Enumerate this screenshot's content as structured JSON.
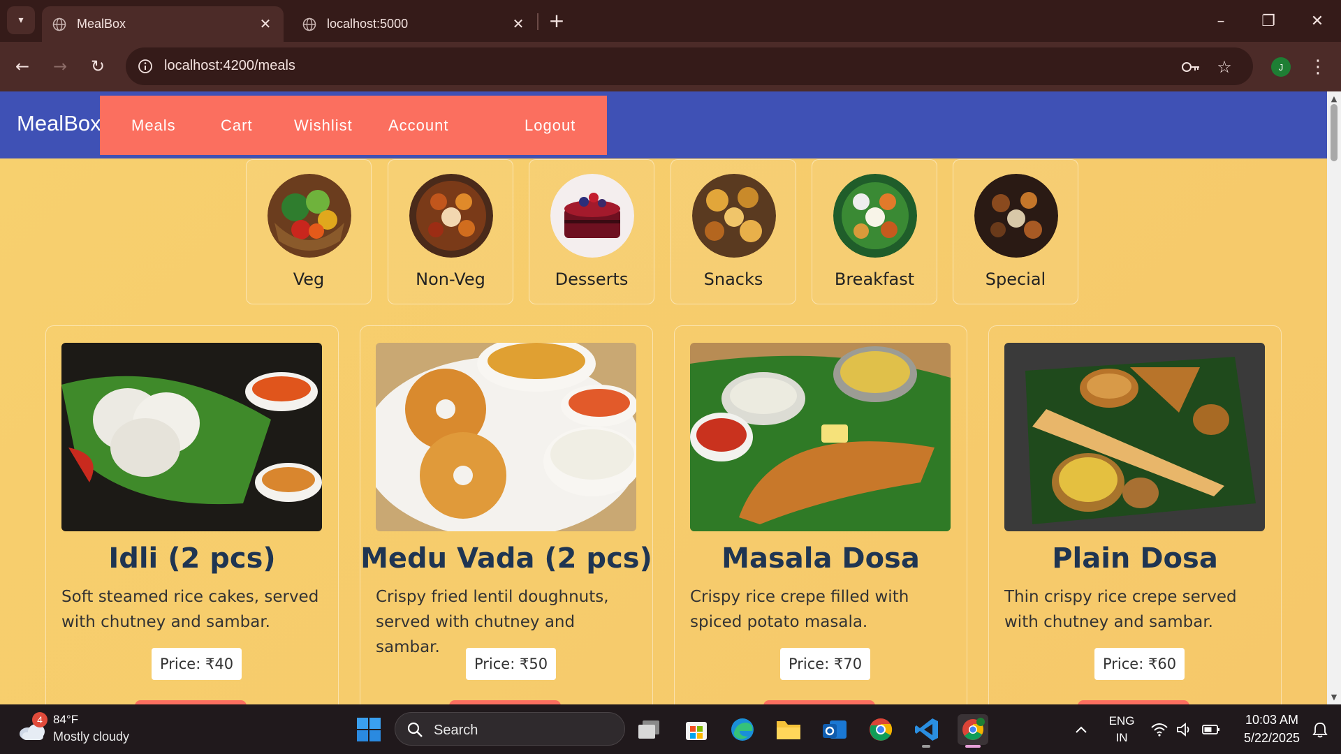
{
  "browser": {
    "tabs": [
      {
        "title": "MealBox",
        "active": true
      },
      {
        "title": "localhost:5000",
        "active": false
      }
    ],
    "address": "localhost:4200/meals",
    "profile_initial": "J"
  },
  "app": {
    "brand": "MealBox",
    "nav": [
      {
        "label": "Meals"
      },
      {
        "label": "Cart"
      },
      {
        "label": "Wishlist"
      },
      {
        "label": "Account"
      },
      {
        "label": "Logout"
      }
    ],
    "categories": [
      {
        "label": "Veg",
        "icon": "vegetable-basket"
      },
      {
        "label": "Non-Veg",
        "icon": "non-veg-platter"
      },
      {
        "label": "Desserts",
        "icon": "berry-cake"
      },
      {
        "label": "Snacks",
        "icon": "snack-assortment"
      },
      {
        "label": "Breakfast",
        "icon": "south-indian-breakfast"
      },
      {
        "label": "Special",
        "icon": "special-thali"
      }
    ],
    "meals": [
      {
        "title": "Idli (2 pcs)",
        "description": "Soft steamed rice cakes, served with chutney and sambar.",
        "price": "Price: ₹40"
      },
      {
        "title": "Medu Vada (2 pcs)",
        "description": "Crispy fried lentil doughnuts, served with chutney and sambar.",
        "price": "Price: ₹50"
      },
      {
        "title": "Masala Dosa",
        "description": "Crispy rice crepe filled with spiced potato masala.",
        "price": "Price: ₹70"
      },
      {
        "title": "Plain Dosa",
        "description": "Thin crispy rice crepe served with chutney and sambar.",
        "price": "Price: ₹60"
      }
    ],
    "colors": {
      "header": "#3f51b5",
      "nav": "#fb6f5f",
      "background": "#f6c86a",
      "title": "#1f3552"
    }
  },
  "taskbar": {
    "weather_badge": "4",
    "temperature": "84°F",
    "weather": "Mostly cloudy",
    "search_placeholder": "Search",
    "language_top": "ENG",
    "language_bottom": "IN",
    "time": "10:03 AM",
    "date": "5/22/2025"
  }
}
